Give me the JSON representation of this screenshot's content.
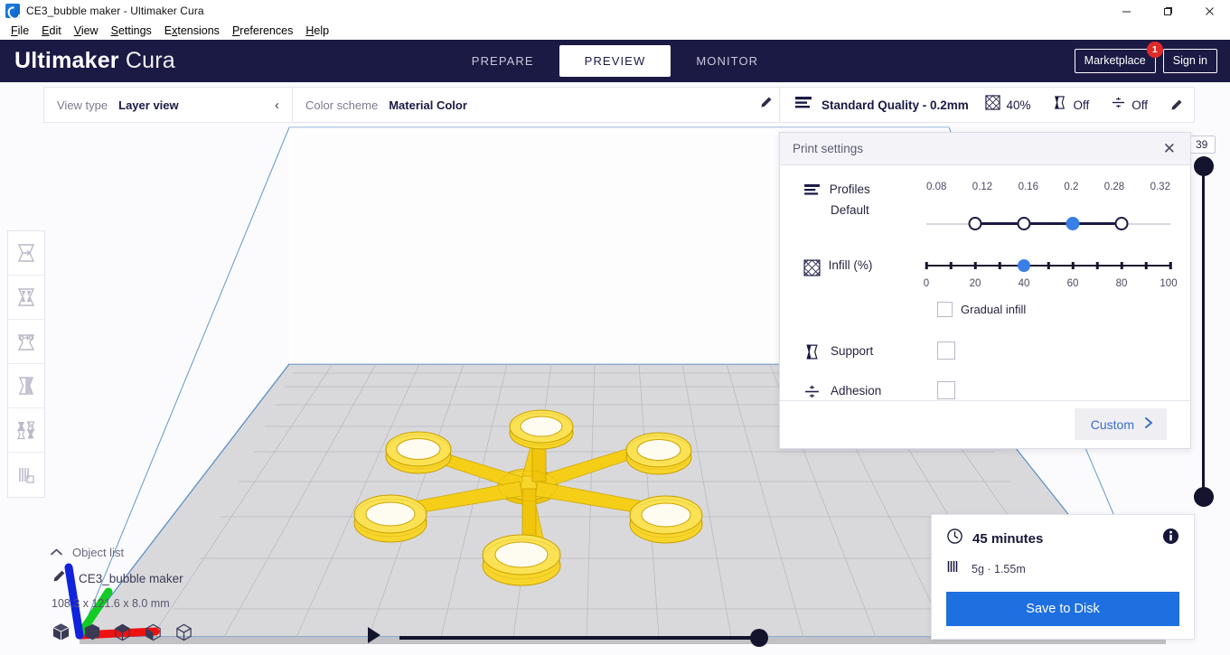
{
  "window": {
    "title": "CE3_bubble maker - Ultimaker Cura",
    "app_icon": "cura-logo-icon",
    "controls": [
      {
        "name": "minimize-button",
        "glyph": "minimize-icon"
      },
      {
        "name": "maximize-button",
        "glyph": "maximize-icon"
      },
      {
        "name": "close-button",
        "glyph": "close-icon"
      }
    ]
  },
  "menubar": {
    "items": [
      {
        "label": "File",
        "accel": "F"
      },
      {
        "label": "Edit",
        "accel": "E"
      },
      {
        "label": "View",
        "accel": "V"
      },
      {
        "label": "Settings",
        "accel": "S"
      },
      {
        "label": "Extensions",
        "accel": "x"
      },
      {
        "label": "Preferences",
        "accel": "P"
      },
      {
        "label": "Help",
        "accel": "H"
      }
    ]
  },
  "header": {
    "brand_bold": "Ultimaker",
    "brand_light": "Cura",
    "stages": [
      {
        "label": "PREPARE",
        "active": false
      },
      {
        "label": "PREVIEW",
        "active": true
      },
      {
        "label": "MONITOR",
        "active": false
      }
    ],
    "marketplace_label": "Marketplace",
    "marketplace_badge": "1",
    "signin_label": "Sign in",
    "bg_color": "#1b1a44"
  },
  "view_bar": {
    "view_type_label": "View type",
    "view_type_value": "Layer view",
    "collapse_icon": "chevron-left-icon",
    "color_scheme_label": "Color scheme",
    "color_scheme_value": "Material Color",
    "edit_icon": "pencil-icon"
  },
  "toolbar": {
    "tools": [
      {
        "name": "move-tool",
        "icon": "move-icon"
      },
      {
        "name": "scale-tool",
        "icon": "scale-icon"
      },
      {
        "name": "rotate-tool",
        "icon": "rotate-icon"
      },
      {
        "name": "mirror-tool",
        "icon": "mirror-icon"
      },
      {
        "name": "per-model-settings-tool",
        "icon": "per-model-settings-icon"
      },
      {
        "name": "support-blocker-tool",
        "icon": "support-blocker-icon"
      }
    ]
  },
  "print_settings_header": {
    "profile_icon": "layers-icon",
    "profile_name": "Standard Quality - 0.2mm",
    "infill_icon": "infill-icon",
    "infill_value": "40%",
    "support_icon": "support-icon",
    "support_value": "Off",
    "adhesion_icon": "adhesion-icon",
    "adhesion_value": "Off",
    "edit_icon": "pencil-icon"
  },
  "print_settings": {
    "title": "Print settings",
    "close_icon": "close-icon",
    "profiles": {
      "label": "Profiles",
      "icon": "layers-icon",
      "sub_label": "Default",
      "ticks": [
        "0.08",
        "0.12",
        "0.16",
        "0.2",
        "0.28",
        "0.32"
      ],
      "available": [
        "0.12",
        "0.16",
        "0.2",
        "0.28"
      ],
      "selected": "0.2"
    },
    "infill": {
      "label": "Infill (%)",
      "icon": "infill-icon",
      "ticks": [
        0,
        10,
        20,
        30,
        40,
        50,
        60,
        70,
        80,
        90,
        100
      ],
      "labels": [
        {
          "value": 0,
          "text": "0"
        },
        {
          "value": 20,
          "text": "20"
        },
        {
          "value": 40,
          "text": "40"
        },
        {
          "value": 60,
          "text": "60"
        },
        {
          "value": 80,
          "text": "80"
        },
        {
          "value": 100,
          "text": "100"
        }
      ],
      "value": 40,
      "gradual_label": "Gradual infill",
      "gradual_checked": false
    },
    "support": {
      "label": "Support",
      "icon": "support-icon",
      "checked": false
    },
    "adhesion": {
      "label": "Adhesion",
      "icon": "adhesion-icon",
      "checked": false
    },
    "custom_label": "Custom",
    "custom_chevron": "chevron-right-icon"
  },
  "layer_slider": {
    "value": "39",
    "top_handle_name": "layer-slider-upper-handle",
    "bottom_handle_name": "layer-slider-lower-handle"
  },
  "object_list": {
    "title": "Object list",
    "caret_icon": "chevron-up-icon",
    "item_icon": "pencil-icon",
    "item_name": "CE3_bubble maker",
    "dimensions": "108.3 x 121.6 x 8.0 mm",
    "view_buttons": [
      {
        "name": "view-3d-button",
        "icon": "cube-3d-icon"
      },
      {
        "name": "view-front-button",
        "icon": "cube-front-icon"
      },
      {
        "name": "view-top-button",
        "icon": "cube-top-icon"
      },
      {
        "name": "view-left-button",
        "icon": "cube-left-icon"
      },
      {
        "name": "view-right-button",
        "icon": "cube-right-icon"
      }
    ]
  },
  "playback": {
    "play_icon": "play-icon",
    "progress": 98
  },
  "job_card": {
    "clock_icon": "clock-icon",
    "time": "45 minutes",
    "info_icon": "info-icon",
    "material_icon": "material-spool-icon",
    "material": "5g · 1.55m",
    "save_label": "Save to Disk",
    "save_color": "#1e6fe0"
  },
  "viewport": {
    "model_color": "#f5cf17",
    "plate_color": "#d6d6d8",
    "outline_color": "#5b8ec4",
    "axes": {
      "x": "#ee1111",
      "y": "#11cc22",
      "z": "#1122dd"
    }
  }
}
